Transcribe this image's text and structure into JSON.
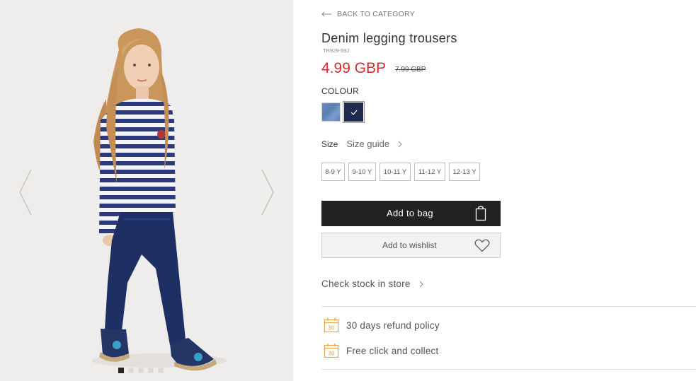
{
  "gallery": {
    "image_alt": "Girl wearing striped long sleeve top, denim leggings and espadrilles",
    "active_index": 0,
    "dots": [
      {
        "active": true
      },
      {
        "active": false
      },
      {
        "active": false
      },
      {
        "active": false
      },
      {
        "active": false
      }
    ]
  },
  "product": {
    "back_label": "BACK TO CATEGORY",
    "title": "Denim legging trousers",
    "sku": "TR929-59J",
    "price": "4.99 GBP",
    "old_price": "7.99 GBP",
    "colour_label": "COLOUR",
    "colours": [
      {
        "name": "light denim",
        "color": "#6a8cbf",
        "selected": false
      },
      {
        "name": "navy",
        "color": "#1f2a4f",
        "selected": true
      }
    ],
    "size_label": "Size",
    "size_guide_label": "Size guide",
    "sizes": [
      "8-9 Y",
      "9-10 Y",
      "10-11 Y",
      "11-12 Y",
      "12-13 Y"
    ],
    "add_to_bag": "Add to bag",
    "add_to_wishlist": "Add to wishlist",
    "check_stock": "Check stock in store",
    "features": [
      {
        "icon": "calendar-30-icon",
        "label": "30 days refund policy"
      },
      {
        "icon": "calendar-30-icon",
        "label": "Free click and collect"
      }
    ],
    "icon_badge_number": "30",
    "accent_color": "#d42d35",
    "icon_color": "#e0a84a"
  }
}
